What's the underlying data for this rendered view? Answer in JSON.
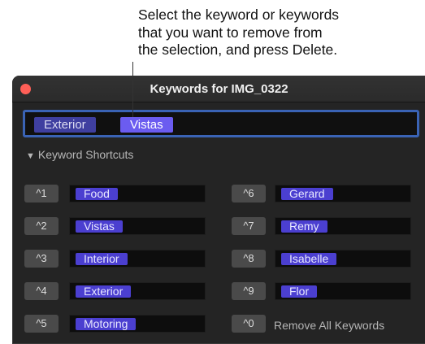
{
  "callout": {
    "lines": [
      "Select the keyword or keywords",
      "that you want to remove from",
      "the selection, and press Delete."
    ]
  },
  "window": {
    "title": "Keywords for IMG_0322",
    "close_color": "#ff5f57"
  },
  "selection": {
    "tokens": [
      {
        "label": "Exterior",
        "selected": false
      },
      {
        "label": "Vistas",
        "selected": true
      }
    ]
  },
  "shortcuts": {
    "header": "Keyword Shortcuts",
    "left": [
      {
        "key": "^1",
        "keyword": "Food"
      },
      {
        "key": "^2",
        "keyword": "Vistas"
      },
      {
        "key": "^3",
        "keyword": "Interior"
      },
      {
        "key": "^4",
        "keyword": "Exterior"
      },
      {
        "key": "^5",
        "keyword": "Motoring"
      }
    ],
    "right": [
      {
        "key": "^6",
        "keyword": "Gerard"
      },
      {
        "key": "^7",
        "keyword": "Remy"
      },
      {
        "key": "^8",
        "keyword": "Isabelle"
      },
      {
        "key": "^9",
        "keyword": "Flor"
      },
      {
        "key": "^0",
        "label": "Remove All Keywords"
      }
    ]
  },
  "colors": {
    "selected_token": "#6b5cf0",
    "unselected_token": "#3f3fa0",
    "keyword_tag": "#4b3fd0",
    "focus_ring": "#3a63b5"
  }
}
